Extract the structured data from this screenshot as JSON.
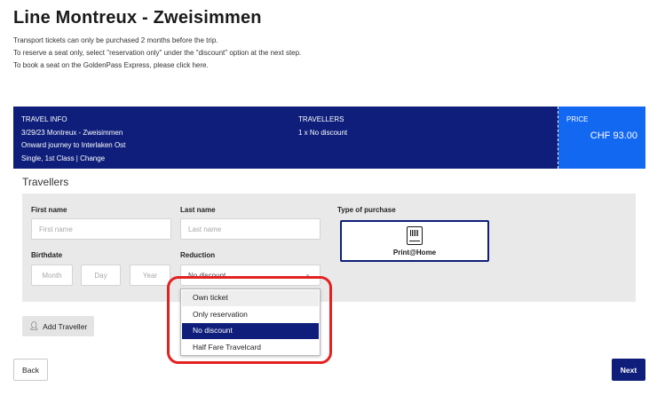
{
  "page": {
    "title": "Line Montreux - Zweisimmen",
    "intro_lines": [
      "Transport tickets can only be purchased 2 months before the trip.",
      "To reserve a seat only, select \"reservation only\" under the \"discount\" option at the next step.",
      "To book a seat on the GoldenPass Express, please click here."
    ]
  },
  "travel_info": {
    "heading": "TRAVEL INFO",
    "lines": [
      "3/29/23 Montreux - Zweisimmen",
      "Onward journey to Interlaken Ost",
      "Single, 1st Class | Change"
    ]
  },
  "travellers_info": {
    "heading": "TRAVELLERS",
    "summary": "1 x No discount"
  },
  "price": {
    "heading": "PRICE",
    "value": "CHF 93.00"
  },
  "form": {
    "title": "Travellers",
    "first_name": {
      "label": "First name",
      "placeholder": "First name"
    },
    "last_name": {
      "label": "Last name",
      "placeholder": "Last name"
    },
    "birthdate": {
      "label": "Birthdate",
      "month": "Month",
      "day": "Day",
      "year": "Year"
    },
    "reduction": {
      "label": "Reduction",
      "selected": "No discount"
    },
    "type_of_purchase": {
      "label": "Type of purchase",
      "option": "Print@Home"
    }
  },
  "reduction_dropdown": {
    "options": [
      "Own ticket",
      "Only reservation",
      "No discount",
      "Half Fare Travelcard"
    ],
    "hovered_index": 0,
    "selected_index": 2
  },
  "buttons": {
    "add_traveller": "Add Traveller",
    "back": "Back",
    "next": "Next"
  },
  "colors": {
    "brand_navy": "#0e1e7a",
    "price_blue": "#1368f2",
    "highlight_red": "#e32121"
  },
  "icons": {
    "add_traveller": "user-plus-icon",
    "purchase": "ticket-barcode-icon",
    "reduction": "chevron-down-icon"
  }
}
